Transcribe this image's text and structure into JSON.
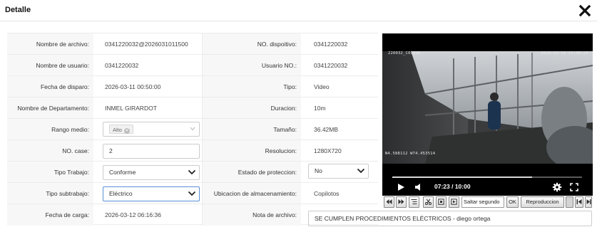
{
  "dialog": {
    "title": "Detalle",
    "close_icon": "close-icon"
  },
  "form": {
    "nombre_archivo": {
      "label": "Nombre de archivo:",
      "value": "0341220032@2026031011500"
    },
    "no_dispositivo": {
      "label": "NO. dispoitivo:",
      "value": "0341220032"
    },
    "nombre_usuario": {
      "label": "Nombre de usuario:",
      "value": "0341220032"
    },
    "usuario_no": {
      "label": "Usuario NO.:",
      "value": "0341220032"
    },
    "fecha_disparo": {
      "label": "Fecha de disparo:",
      "value": "2026-03-11 00:50:00"
    },
    "tipo": {
      "label": "Tipo:",
      "value": "Video"
    },
    "departamento": {
      "label": "Nombre de Departamento:",
      "value": "INMEL GIRARDOT"
    },
    "duracion": {
      "label": "Duracion:",
      "value": "10m"
    },
    "rango_medio": {
      "label": "Rango medio:",
      "tag": "Alto"
    },
    "tamano": {
      "label": "Tamaño:",
      "value": "36.42MB"
    },
    "no_case": {
      "label": "NO. case:",
      "value": "2"
    },
    "resolucion": {
      "label": "Resolucion:",
      "value": "1280X720"
    },
    "tipo_trabajo": {
      "label": "Tipo Trabajo:",
      "value": "Conforme"
    },
    "estado_proteccion": {
      "label": "Estado de proteccion:",
      "value": "No"
    },
    "tipo_subtrabajo": {
      "label": "Tipo subtrabajo:",
      "value": "Eléctrico"
    },
    "ubicacion": {
      "label": "Ubicacion de almacenamiento:",
      "value": "Copilotos"
    },
    "fecha_carga": {
      "label": "Fecha de carga:",
      "value": "2026-03-12 06:16:36"
    },
    "nota_archivo": {
      "label": "Nota de archivo:",
      "value": "SE CUMPLEN PROCEDIMIENTOS ELÉCTRICOS - diego ortega"
    }
  },
  "video": {
    "osd_top_left": "220032_C03000",
    "osd_top_right": "2026-03-11 11:48:24",
    "osd_bottom_left": "N4.588112 W74.453514",
    "time": "07:23 / 10:00",
    "progress": 0.738,
    "icons": [
      "play-icon",
      "volume-icon",
      "settings-icon",
      "fullscreen-icon"
    ]
  },
  "toolbar": {
    "saltar_label": "Saltar segundo",
    "ok_label": "OK",
    "reproduccion_label": "Reproduccion",
    "icons": [
      "rewind-icon",
      "fast-forward-icon",
      "list-icon",
      "cut-icon",
      "stop-frame-icon",
      "next-frame-icon",
      "skip-start-icon",
      "skip-end-icon"
    ]
  }
}
